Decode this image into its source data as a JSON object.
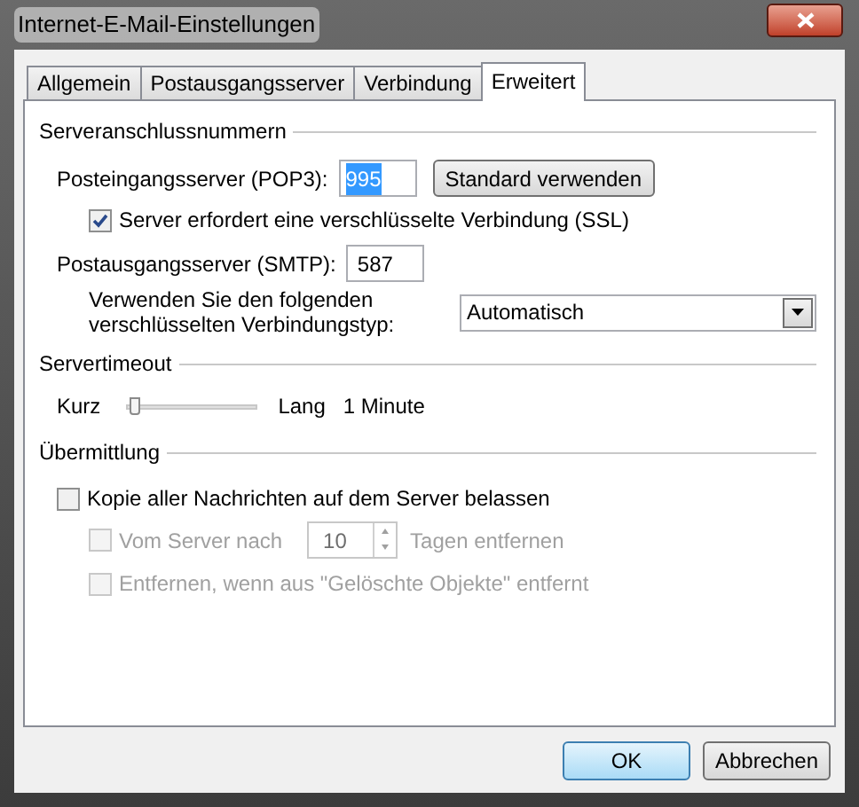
{
  "window": {
    "title": "Internet-E-Mail-Einstellungen"
  },
  "tabs": [
    {
      "label": "Allgemein",
      "selected": false
    },
    {
      "label": "Postausgangsserver",
      "selected": false
    },
    {
      "label": "Verbindung",
      "selected": false
    },
    {
      "label": "Erweitert",
      "selected": true
    }
  ],
  "server_ports": {
    "heading": "Serveranschlussnummern",
    "incoming": {
      "label": "Posteingangsserver (POP3):",
      "value": "995",
      "value_selected": true
    },
    "default_button": "Standard verwenden",
    "ssl": {
      "label": "Server erfordert eine verschlüsselte Verbindung (SSL)",
      "checked": true,
      "disabled": false
    },
    "outgoing": {
      "label": "Postausgangsserver (SMTP):",
      "value": "587"
    },
    "encryption": {
      "label": "Verwenden Sie den folgenden verschlüsselten Verbindungstyp:",
      "value": "Automatisch"
    }
  },
  "server_timeout": {
    "heading": "Servertimeout",
    "min_label": "Kurz",
    "max_label": "Lang",
    "level": 0.05,
    "reading": "1 Minute"
  },
  "delivery": {
    "heading": "Übermittlung",
    "keep_copy": {
      "label": "Kopie aller Nachrichten auf dem Server belassen",
      "checked": false,
      "disabled": false
    },
    "remove_after": {
      "label": "Vom Server nach",
      "checked": false,
      "disabled": true,
      "days": "10",
      "suffix": "Tagen entfernen"
    },
    "remove_deleted": {
      "label": "Entfernen, wenn aus \"Gelöschte Objekte\" entfernt",
      "checked": false,
      "disabled": true
    }
  },
  "buttons": [
    {
      "label": "OK",
      "default": true
    },
    {
      "label": "Abbrechen",
      "default": false
    }
  ]
}
